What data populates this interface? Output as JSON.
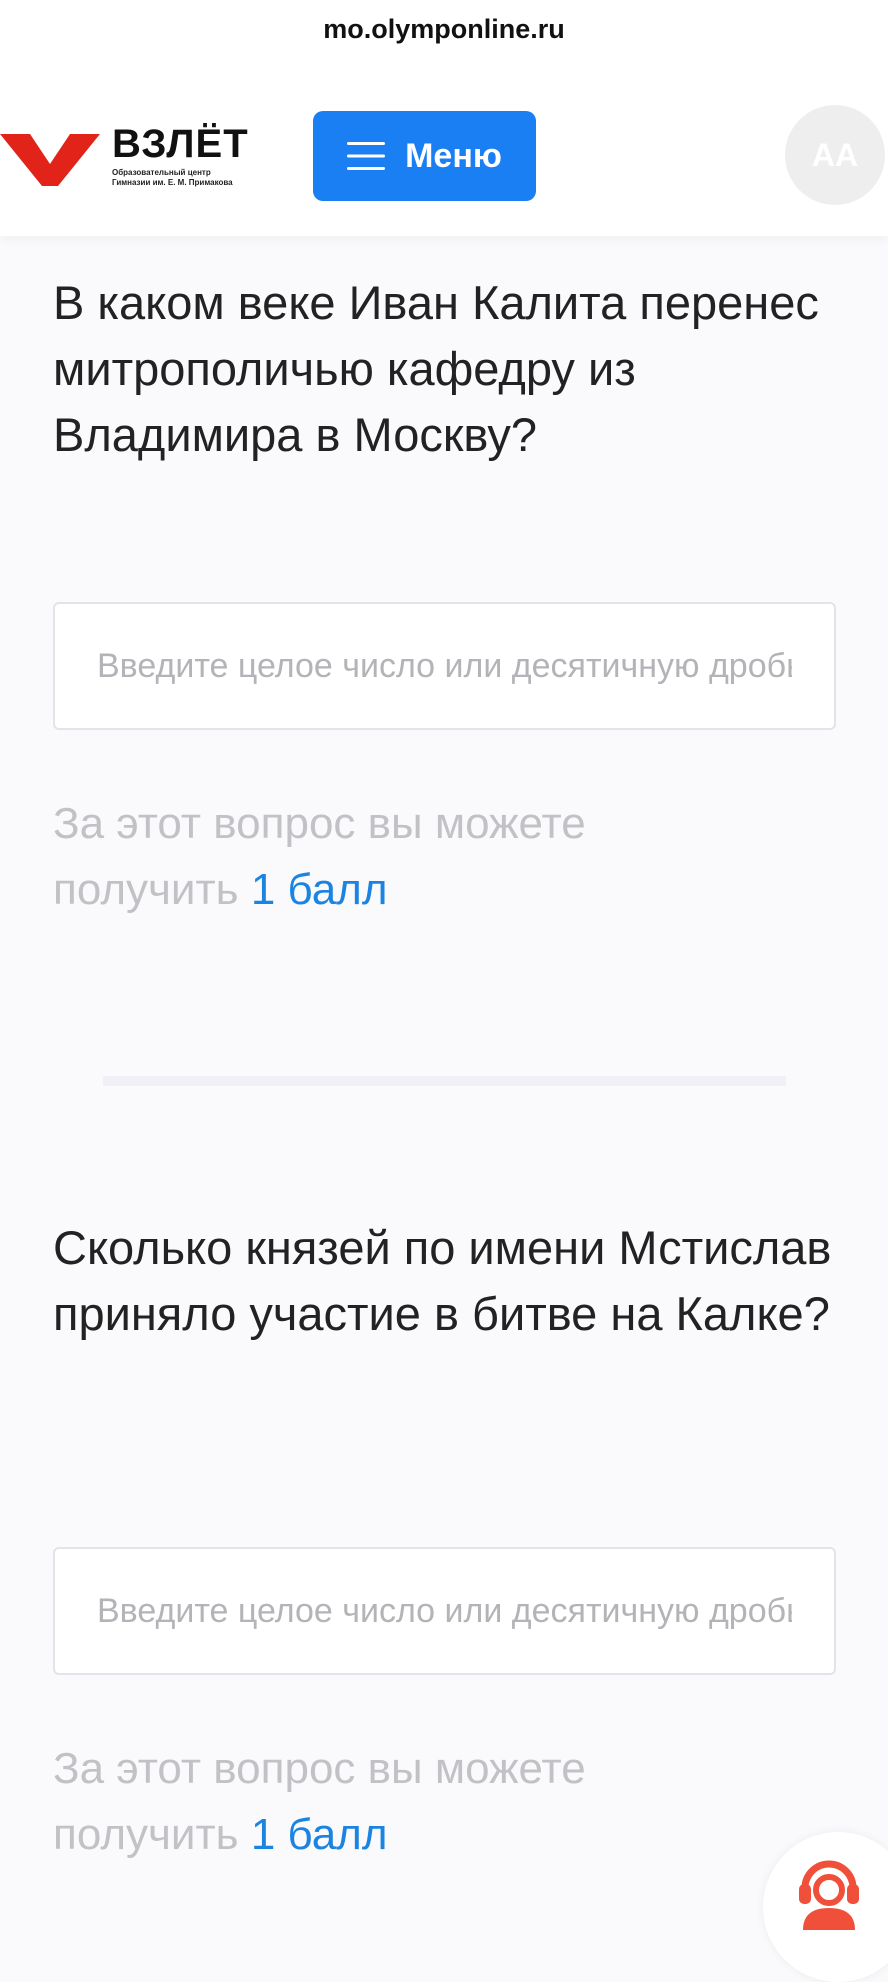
{
  "browser": {
    "url": "mo.olymponline.ru"
  },
  "header": {
    "logo_title": "ВЗЛЁТ",
    "logo_subtitle_line1": "Образовательный центр",
    "logo_subtitle_line2": "Гимназии им. Е. М. Примакова",
    "menu_label": "Меню",
    "menu_icon": "hamburger-icon",
    "avatar_initials": "AA"
  },
  "questions": [
    {
      "text": "В каком веке Иван Калита перенес митрополичью кафедру из Владимира в Москву?",
      "input_placeholder": "Введите целое число или десятичную дробь",
      "input_value": "",
      "points_prefix": "За этот вопрос вы можете получить",
      "points_value": "1 балл"
    },
    {
      "text": "Сколько князей по имени Мстислав приняло участие в битве на Калке?",
      "input_placeholder": "Введите целое число или десятичную дробь",
      "input_value": "",
      "points_prefix": "За этот вопрос вы можете получить",
      "points_value": "1 балл"
    }
  ],
  "support": {
    "icon": "support-headset-icon"
  },
  "colors": {
    "brand_red": "#e2231a",
    "accent_blue": "#1a7ff2",
    "link_blue": "#1a84e0",
    "muted_text": "#c2c2c6"
  }
}
